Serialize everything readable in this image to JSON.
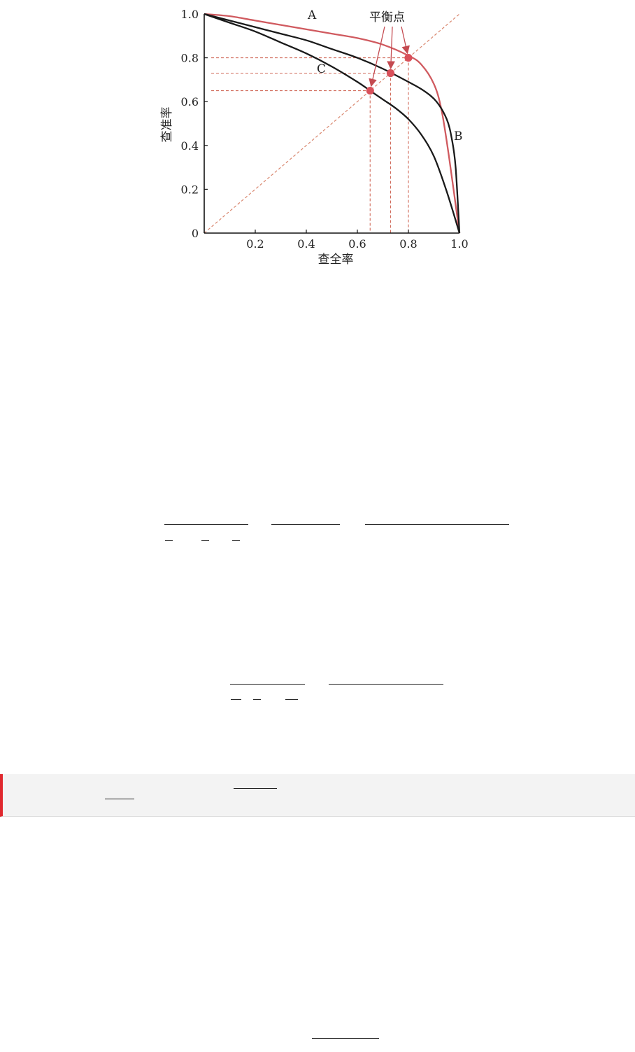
{
  "chart_data": {
    "type": "line",
    "xlabel": "查全率",
    "ylabel": "查准率",
    "xlim": [
      0,
      1.0
    ],
    "ylim": [
      0,
      1.0
    ],
    "x_ticks": [
      "0.2",
      "0.4",
      "0.6",
      "0.8",
      "1.0"
    ],
    "y_ticks": [
      "0",
      "0.2",
      "0.4",
      "0.6",
      "0.8",
      "1.0"
    ],
    "grid": false,
    "series": [
      {
        "name": "A",
        "color": "#d05a5f",
        "x": [
          0,
          0.1,
          0.2,
          0.3,
          0.4,
          0.5,
          0.6,
          0.7,
          0.8,
          0.85,
          0.9,
          0.93,
          0.96,
          1.0
        ],
        "y": [
          1.0,
          0.99,
          0.97,
          0.95,
          0.93,
          0.91,
          0.89,
          0.86,
          0.81,
          0.77,
          0.68,
          0.56,
          0.34,
          0.0
        ]
      },
      {
        "name": "B",
        "color": "#1a1a1a",
        "x": [
          0,
          0.1,
          0.2,
          0.3,
          0.4,
          0.5,
          0.6,
          0.7,
          0.8,
          0.86,
          0.91,
          0.95,
          0.97,
          0.985,
          1.0
        ],
        "y": [
          1.0,
          0.97,
          0.94,
          0.91,
          0.88,
          0.84,
          0.8,
          0.75,
          0.69,
          0.65,
          0.6,
          0.52,
          0.43,
          0.3,
          0.0
        ]
      },
      {
        "name": "C",
        "color": "#1a1a1a",
        "x": [
          0,
          0.1,
          0.2,
          0.3,
          0.4,
          0.5,
          0.6,
          0.65,
          0.7,
          0.75,
          0.8,
          0.85,
          0.9,
          0.95,
          1.0
        ],
        "y": [
          1.0,
          0.96,
          0.92,
          0.87,
          0.82,
          0.76,
          0.69,
          0.65,
          0.61,
          0.57,
          0.52,
          0.45,
          0.35,
          0.19,
          0.0
        ]
      }
    ],
    "reference_line": {
      "from": [
        0,
        0
      ],
      "to": [
        1.0,
        1.0
      ],
      "color": "#d9876f",
      "style": "dashed"
    },
    "balance_points": [
      {
        "series": "C",
        "x": 0.65,
        "y": 0.65
      },
      {
        "series": "B",
        "x": 0.73,
        "y": 0.73
      },
      {
        "series": "A",
        "x": 0.8,
        "y": 0.8
      }
    ],
    "annotation": {
      "label": "平衡点"
    },
    "point_color": "#d9505a"
  }
}
